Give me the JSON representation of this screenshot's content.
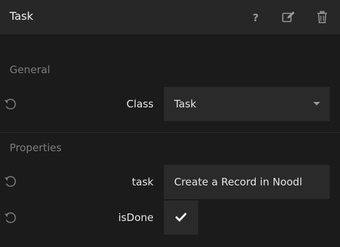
{
  "header": {
    "title": "Task",
    "icons": [
      "help-icon",
      "edit-icon",
      "trash-icon"
    ]
  },
  "general": {
    "section_label": "General",
    "class_label": "Class",
    "class_value": "Task"
  },
  "properties": {
    "section_label": "Properties",
    "task_label": "task",
    "task_value": "Create a Record in Noodl",
    "isdone_label": "isDone",
    "isdone_checked": true
  }
}
